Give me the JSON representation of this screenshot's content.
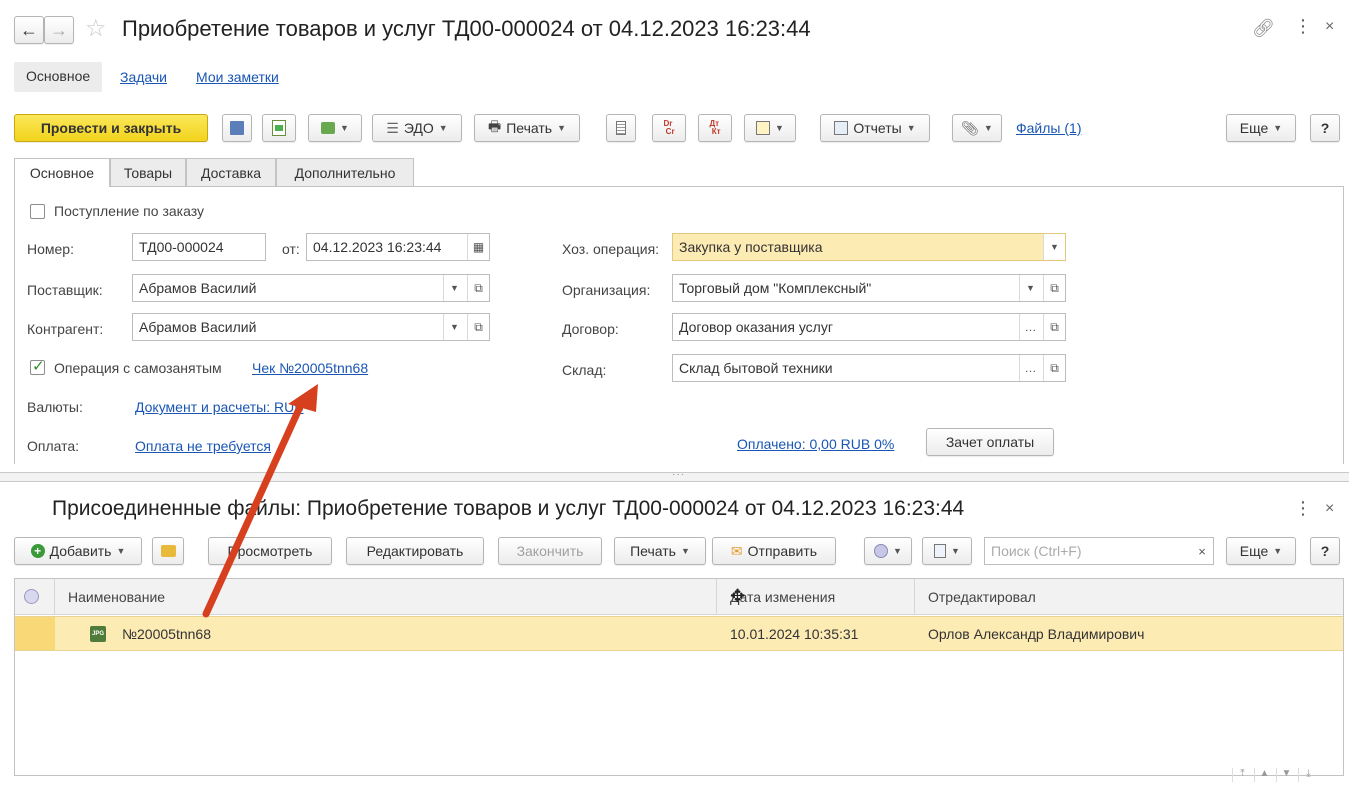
{
  "window": {
    "title": "Приобретение товаров и услуг ТД00-000024 от 04.12.2023 16:23:44",
    "nav_tabs": [
      "Основное",
      "Задачи",
      "Мои заметки"
    ]
  },
  "toolbar": {
    "post_close": "Провести и закрыть",
    "edo": "ЭДО",
    "print": "Печать",
    "dt_kt_1": "Dr Cr",
    "dt_kt_2": "Дт Кт",
    "reports": "Отчеты",
    "files_link": "Файлы (1)",
    "more": "Еще",
    "help": "?"
  },
  "form_tabs": [
    "Основное",
    "Товары",
    "Доставка",
    "Дополнительно"
  ],
  "form": {
    "by_order_label": "Поступление по заказу",
    "number_label": "Номер:",
    "number_value": "ТД00-000024",
    "date_prefix": "от:",
    "date_value": "04.12.2023 16:23:44",
    "supplier_label": "Поставщик:",
    "supplier_value": "Абрамов Василий",
    "counterparty_label": "Контрагент:",
    "counterparty_value": "Абрамов Василий",
    "self_employed_label": "Операция с самозанятым",
    "receipt_link": "Чек №20005tnn68",
    "currency_label": "Валюты:",
    "currency_link": "Документ и расчеты: RUB",
    "payment_label": "Оплата:",
    "payment_link": "Оплата не требуется",
    "operation_label": "Хоз. операция:",
    "operation_value": "Закупка у поставщика",
    "org_label": "Организация:",
    "org_value": "Торговый дом \"Комплексный\"",
    "contract_label": "Договор:",
    "contract_value": "Договор оказания услуг",
    "warehouse_label": "Склад:",
    "warehouse_value": "Склад бытовой техники",
    "paid_link": "Оплачено: 0,00 RUB 0%",
    "offset_button": "Зачет оплаты"
  },
  "files_panel": {
    "title": "Присоединенные файлы: Приобретение товаров и услуг ТД00-000024 от 04.12.2023 16:23:44",
    "add": "Добавить",
    "view": "Просмотреть",
    "edit": "Редактировать",
    "finish": "Закончить",
    "print": "Печать",
    "send": "Отправить",
    "search_placeholder": "Поиск (Ctrl+F)",
    "more": "Еще",
    "help": "?",
    "columns": [
      "Наименование",
      "Дата изменения",
      "Отредактировал"
    ],
    "rows": [
      {
        "name": "№20005tnn68",
        "date": "10.01.2024 10:35:31",
        "editor": "Орлов Александр Владимирович",
        "file_type": "JPG"
      }
    ]
  },
  "colors": {
    "accent_yellow": "#f7df2e",
    "highlight": "#fdebb4",
    "link": "#1a56b4",
    "arrow": "#d7401e"
  }
}
